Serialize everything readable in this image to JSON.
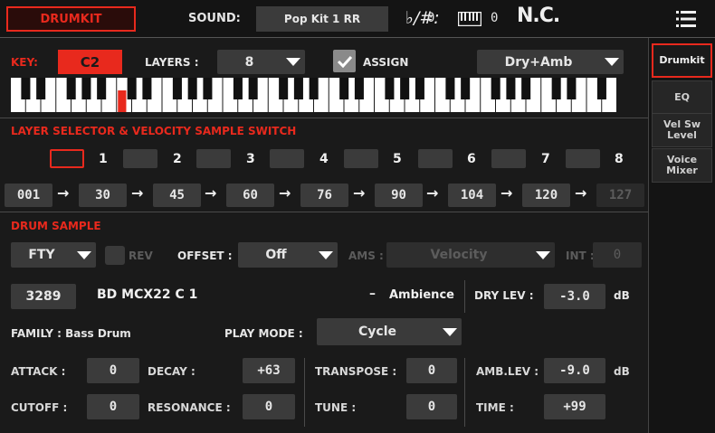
{
  "topbar": {
    "mode": "DRUMKIT",
    "sound_label": "SOUND:",
    "sound_value": "Pop Kit 1 RR",
    "flat_sharp_symbol": "♭/#:",
    "flat_sharp_value": "0",
    "keyboard_value": "0",
    "chord": "N.C."
  },
  "sidebar": {
    "tabs": [
      {
        "label": "Drumkit",
        "active": true
      },
      {
        "label": "EQ",
        "active": false
      },
      {
        "label": "Vel Sw Level",
        "active": false
      },
      {
        "label": "Voice Mixer",
        "active": false
      }
    ]
  },
  "key_row": {
    "key_label": "KEY:",
    "key_value": "C2",
    "layers_label": "LAYERS :",
    "layers_value": "8",
    "assign_label": "ASSIGN",
    "assign_checked": true,
    "dry_amb_value": "Dry+Amb"
  },
  "layer_selector": {
    "title": "LAYER SELECTOR & VELOCITY SAMPLE SWITCH",
    "layers": [
      "1",
      "2",
      "3",
      "4",
      "5",
      "6",
      "7",
      "8"
    ],
    "selected_layer": 1,
    "velocities": [
      "001",
      "30",
      "45",
      "60",
      "76",
      "90",
      "104",
      "120",
      "127"
    ],
    "arrow": "→"
  },
  "drum_sample": {
    "title": "DRUM SAMPLE",
    "bank_value": "FTY",
    "rev_label": "REV",
    "offset_label": "OFFSET :",
    "offset_value": "Off",
    "ams_label": "AMS :",
    "ams_value": "Velocity",
    "int_label": "INT :",
    "int_value": "0",
    "sample_number": "3289",
    "sample_name": "BD MCX22 C 1",
    "ambience_dash": "–",
    "ambience_name": "Ambience",
    "dry_lev_label": "DRY LEV :",
    "dry_lev_value": "-3.0",
    "dry_lev_unit": "dB",
    "family_label": "FAMILY : Bass Drum",
    "play_mode_label": "PLAY MODE :",
    "play_mode_value": "Cycle"
  },
  "params": {
    "attack_label": "ATTACK :",
    "attack_value": "0",
    "decay_label": "DECAY :",
    "decay_value": "+63",
    "transpose_label": "TRANSPOSE :",
    "transpose_value": "0",
    "amb_lev_label": "AMB.LEV :",
    "amb_lev_value": "-9.0",
    "amb_lev_unit": "dB",
    "cutoff_label": "CUTOFF :",
    "cutoff_value": "0",
    "resonance_label": "RESONANCE :",
    "resonance_value": "0",
    "tune_label": "TUNE :",
    "tune_value": "0",
    "time_label": "TIME :",
    "time_value": "+99"
  },
  "colors": {
    "accent": "#e8291d",
    "background": "#1a1a1a",
    "field": "#3b3b3b",
    "text": "#e6e6e6",
    "disabled_text": "#5c5c5c"
  }
}
